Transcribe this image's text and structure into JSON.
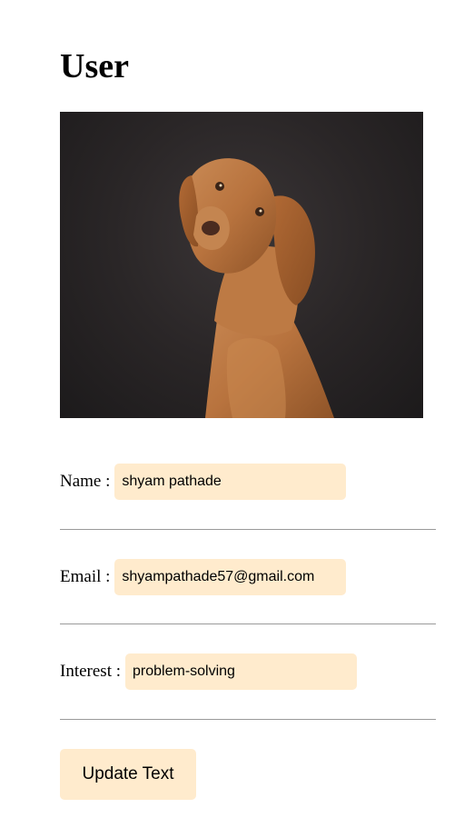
{
  "page": {
    "title": "User"
  },
  "profile_image": {
    "subject": "dog-photo"
  },
  "fields": {
    "name": {
      "label": "Name :",
      "value": "shyam pathade"
    },
    "email": {
      "label": "Email :",
      "value": "shyampathade57@gmail.com"
    },
    "interest": {
      "label": "Interest :",
      "value": "problem-solving"
    }
  },
  "actions": {
    "update_label": "Update Text"
  },
  "colors": {
    "input_background": "#ffebcd",
    "divider": "#9a9a9a",
    "photo_background": "#2a2627"
  }
}
